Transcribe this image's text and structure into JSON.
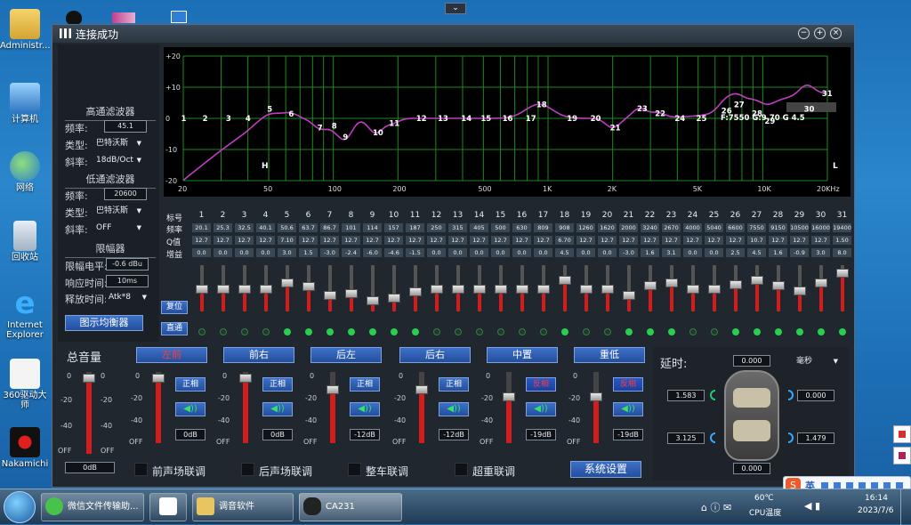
{
  "window": {
    "title": "连接成功"
  },
  "desktop_icons": [
    "Administr...",
    "计算机",
    "网络",
    "回收站",
    "Internet Explorer",
    "360驱动大师",
    "Nakamichi"
  ],
  "highpass": {
    "title": "高通滤波器",
    "freq_label": "频率:",
    "freq": "45.1",
    "type_label": "类型:",
    "type": "巴特沃斯",
    "slope_label": "斜率:",
    "slope": "18dB/Oct"
  },
  "lowpass": {
    "title": "低通滤波器",
    "freq_label": "频率:",
    "freq": "20600",
    "type_label": "类型:",
    "type": "巴特沃斯",
    "slope_label": "斜率:",
    "slope": "OFF"
  },
  "limiter": {
    "title": "限幅器",
    "level_label": "限幅电平:",
    "level": "-0.6 dBu",
    "attack_label": "响应时间:",
    "attack": "10ms",
    "release_label": "释放时间:",
    "release": "Atk*8"
  },
  "graphic_eq_button": "图示均衡器",
  "reset_button": "复位",
  "bypass_button": "直通",
  "graph": {
    "y_ticks": [
      "+20",
      "+10",
      "0",
      "-10",
      "-20"
    ],
    "x_ticks": [
      "20",
      "50",
      "100",
      "200",
      "500",
      "1K",
      "2K",
      "5K",
      "10K",
      "20KHz"
    ],
    "markers": {
      "H": "H",
      "L": "L",
      "overlay": "F:7550 G:9.70 G 4.5"
    }
  },
  "table_labels": {
    "num": "标号",
    "freq": "频率",
    "q": "Q值",
    "gain": "增益"
  },
  "bands": [
    {
      "n": "1",
      "f": "20.1",
      "q": "12.7",
      "g": "0.0"
    },
    {
      "n": "2",
      "f": "25.3",
      "q": "12.7",
      "g": "0.0"
    },
    {
      "n": "3",
      "f": "32.5",
      "q": "12.7",
      "g": "0.0"
    },
    {
      "n": "4",
      "f": "40.1",
      "q": "12.7",
      "g": "0.0"
    },
    {
      "n": "5",
      "f": "50.6",
      "q": "7.10",
      "g": "3.0"
    },
    {
      "n": "6",
      "f": "63.7",
      "q": "12.7",
      "g": "1.5"
    },
    {
      "n": "7",
      "f": "86.7",
      "q": "12.7",
      "g": "-3.0"
    },
    {
      "n": "8",
      "f": "101",
      "q": "12.7",
      "g": "-2.4"
    },
    {
      "n": "9",
      "f": "114",
      "q": "12.7",
      "g": "-6.0"
    },
    {
      "n": "10",
      "f": "157",
      "q": "12.7",
      "g": "-4.6"
    },
    {
      "n": "11",
      "f": "187",
      "q": "12.7",
      "g": "-1.5"
    },
    {
      "n": "12",
      "f": "250",
      "q": "12.7",
      "g": "0.0"
    },
    {
      "n": "13",
      "f": "315",
      "q": "12.7",
      "g": "0.0"
    },
    {
      "n": "14",
      "f": "405",
      "q": "12.7",
      "g": "0.0"
    },
    {
      "n": "15",
      "f": "500",
      "q": "12.7",
      "g": "0.0"
    },
    {
      "n": "16",
      "f": "630",
      "q": "12.7",
      "g": "0.0"
    },
    {
      "n": "17",
      "f": "809",
      "q": "12.7",
      "g": "0.0"
    },
    {
      "n": "18",
      "f": "908",
      "q": "6.70",
      "g": "4.5"
    },
    {
      "n": "19",
      "f": "1260",
      "q": "12.7",
      "g": "0.0"
    },
    {
      "n": "20",
      "f": "1620",
      "q": "12.7",
      "g": "0.0"
    },
    {
      "n": "21",
      "f": "2000",
      "q": "12.7",
      "g": "-3.0"
    },
    {
      "n": "22",
      "f": "3240",
      "q": "12.7",
      "g": "1.6"
    },
    {
      "n": "23",
      "f": "2670",
      "q": "12.7",
      "g": "3.1"
    },
    {
      "n": "24",
      "f": "4000",
      "q": "12.7",
      "g": "0.0"
    },
    {
      "n": "25",
      "f": "5040",
      "q": "12.7",
      "g": "0.0"
    },
    {
      "n": "26",
      "f": "6600",
      "q": "12.7",
      "g": "2.5"
    },
    {
      "n": "27",
      "f": "7550",
      "q": "10.7",
      "g": "4.5"
    },
    {
      "n": "28",
      "f": "9150",
      "q": "12.7",
      "g": "1.6"
    },
    {
      "n": "29",
      "f": "10500",
      "q": "12.7",
      "g": "-0.9"
    },
    {
      "n": "30",
      "f": "16000",
      "q": "12.7",
      "g": "3.0"
    },
    {
      "n": "31",
      "f": "19400",
      "q": "1.50",
      "g": "8.0"
    }
  ],
  "master": {
    "title": "总音量",
    "value": "0dB",
    "scale": [
      "0",
      "-20",
      "-40",
      "OFF"
    ]
  },
  "channels": [
    {
      "name": "左前",
      "phase": "正相",
      "value": "0dB",
      "name_red": true,
      "phase_red": false
    },
    {
      "name": "前右",
      "phase": "正相",
      "value": "0dB",
      "name_red": false,
      "phase_red": false
    },
    {
      "name": "后左",
      "phase": "正相",
      "value": "-12dB",
      "name_red": false,
      "phase_red": false
    },
    {
      "name": "后右",
      "phase": "正相",
      "value": "-12dB",
      "name_red": false,
      "phase_red": false
    },
    {
      "name": "中置",
      "phase": "反相",
      "value": "-19dB",
      "name_red": false,
      "phase_red": true
    },
    {
      "name": "重低",
      "phase": "反相",
      "value": "-19dB",
      "name_red": false,
      "phase_red": true
    }
  ],
  "channel_scale": [
    "0",
    "-20",
    "-40",
    "OFF"
  ],
  "links": [
    "前声场联调",
    "后声场联调",
    "整车联调",
    "超重联调"
  ],
  "system_button": "系统设置",
  "delay": {
    "title": "延时:",
    "unit": "毫秒",
    "top": "0.000",
    "left_front": "1.583",
    "right_front": "0.000",
    "left_rear": "3.125",
    "right_rear": "1.479",
    "bottom": "0.000"
  },
  "taskbar": {
    "items": [
      "微信文件传输助...",
      "调音软件",
      "CA231"
    ],
    "temp": "60℃",
    "temp_label": "CPU温度",
    "time": "16:14",
    "date": "2023/7/6"
  },
  "ime": {
    "label": "英"
  },
  "colors": {
    "accent": "#3c70c8",
    "curve": "#c03cc0",
    "grid": "#1c8a1c",
    "fader": "#d31c1c",
    "led": "#25d14b"
  }
}
